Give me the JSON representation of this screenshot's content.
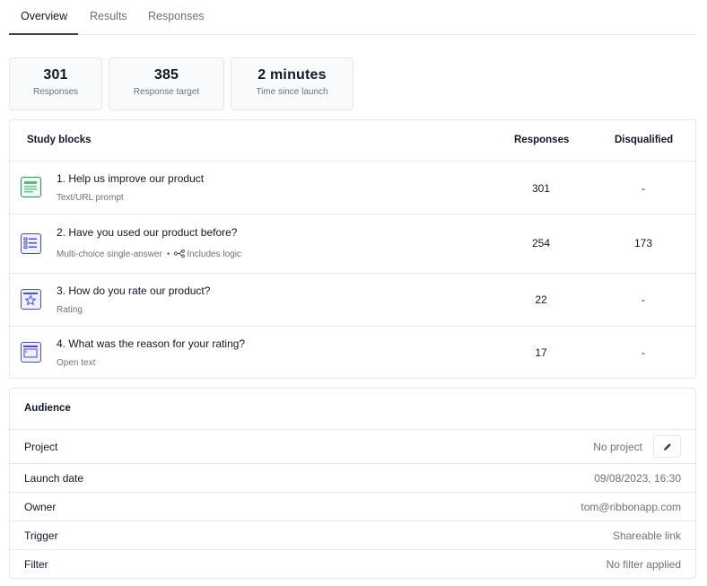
{
  "tabs": [
    {
      "label": "Overview",
      "active": true
    },
    {
      "label": "Results",
      "active": false
    },
    {
      "label": "Responses",
      "active": false
    }
  ],
  "stats": [
    {
      "value": "301",
      "label": "Responses"
    },
    {
      "value": "385",
      "label": "Response target"
    },
    {
      "value": "2 minutes",
      "label": "Time since launch"
    }
  ],
  "study_blocks": {
    "header": {
      "title": "Study blocks",
      "responses": "Responses",
      "disqualified": "Disqualified"
    },
    "rows": [
      {
        "title": "1. Help us improve our product",
        "type": "Text/URL prompt",
        "logic": "",
        "responses": "301",
        "disqualified": "-",
        "icon": "text-prompt-icon",
        "color": "#16a34a"
      },
      {
        "title": "2. Have you used our product before?",
        "type": "Multi-choice single-answer",
        "logic": "Includes logic",
        "responses": "254",
        "disqualified": "173",
        "icon": "multi-choice-icon",
        "color": "#4f46e5"
      },
      {
        "title": "3. How do you rate our product?",
        "type": "Rating",
        "logic": "",
        "responses": "22",
        "disqualified": "-",
        "icon": "star-rating-icon",
        "color": "#4f46e5"
      },
      {
        "title": "4. What was the reason for your rating?",
        "type": "Open text",
        "logic": "",
        "responses": "17",
        "disqualified": "-",
        "icon": "open-text-icon",
        "color": "#4f46e5"
      }
    ]
  },
  "audience": {
    "title": "Audience",
    "rows": [
      {
        "label": "Project",
        "value": "No project"
      },
      {
        "label": "Launch date",
        "value": "09/08/2023, 16:30"
      },
      {
        "label": "Owner",
        "value": "tom@ribbonapp.com"
      },
      {
        "label": "Trigger",
        "value": "Shareable link"
      },
      {
        "label": "Filter",
        "value": "No filter applied"
      }
    ]
  },
  "colors": {
    "border": "#e5e7eb",
    "green": "#16a34a",
    "indigo": "#4f46e5",
    "muted": "#6b7280"
  }
}
